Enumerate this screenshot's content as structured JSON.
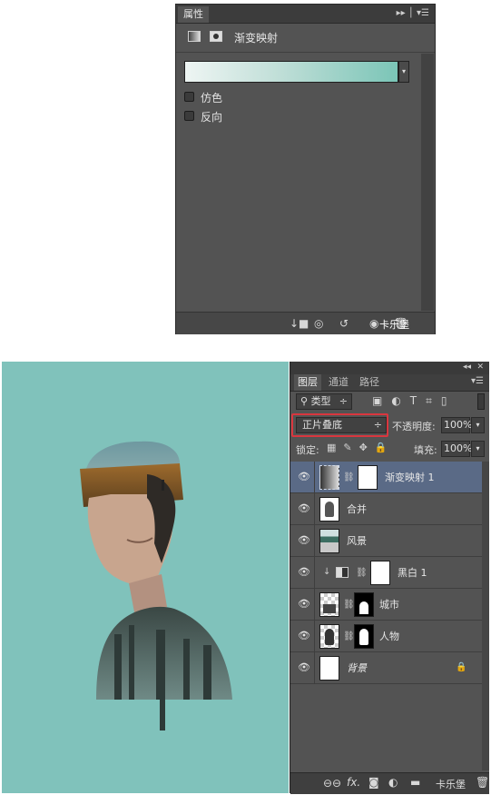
{
  "properties": {
    "tab": "属性",
    "adjustment_title": "渐变映射",
    "options": [
      {
        "label": "仿色",
        "checked": false
      },
      {
        "label": "反向",
        "checked": false
      }
    ],
    "gradient_colors": [
      "#eef5f3",
      "#7bc5b7"
    ],
    "watermark": "卡乐堡"
  },
  "layers_panel": {
    "tabs": [
      "图层",
      "通道",
      "路径"
    ],
    "filter_label": "类型",
    "blend_mode": "正片叠底",
    "opacity_label": "不透明度:",
    "opacity": "100%",
    "lock_label": "锁定:",
    "fill_label": "填充:",
    "fill": "100%",
    "layers": [
      {
        "name": "渐变映射 1",
        "selected": true
      },
      {
        "name": "合并"
      },
      {
        "name": "风景"
      },
      {
        "name": "黑白 1"
      },
      {
        "name": "城市"
      },
      {
        "name": "人物"
      },
      {
        "name": "背景",
        "locked": true
      }
    ],
    "watermark": "卡乐堡"
  },
  "colors": {
    "canvas_bg": "#80c2bb",
    "panel_bg": "#535353",
    "selected_row": "#5a6a86",
    "highlight_box": "#d9363e"
  }
}
